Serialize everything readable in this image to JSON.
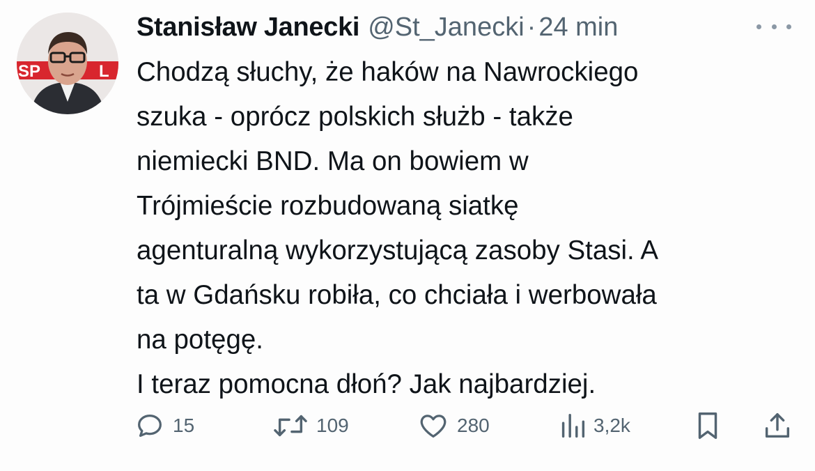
{
  "author": {
    "name": "Stanisław Janecki",
    "handle": "@St_Janecki",
    "separator": "·",
    "time": "24 min"
  },
  "avatar": {
    "background_text": "SP"
  },
  "tweet": {
    "lines": [
      "Chodzą słuchy, że haków na Nawrockiego",
      "szuka - oprócz polskich służb - także",
      "niemiecki BND. Ma on bowiem w",
      "Trójmieście rozbudowaną siatkę",
      "agenturalną wykorzystującą zasoby Stasi. A",
      "ta w Gdańsku robiła, co chciała i werbowała",
      "na potęgę.",
      "I teraz pomocna dłoń? Jak najbardziej."
    ]
  },
  "actions": {
    "reply": {
      "icon": "reply-icon",
      "count": "15"
    },
    "retweet": {
      "icon": "retweet-icon",
      "count": "109"
    },
    "like": {
      "icon": "heart-icon",
      "count": "280"
    },
    "views": {
      "icon": "views-icon",
      "count": "3,2k"
    },
    "bookmark": {
      "icon": "bookmark-icon"
    },
    "share": {
      "icon": "share-icon"
    }
  },
  "colors": {
    "text": "#0f1419",
    "muted": "#536471",
    "avatar_red": "#d8262e"
  }
}
